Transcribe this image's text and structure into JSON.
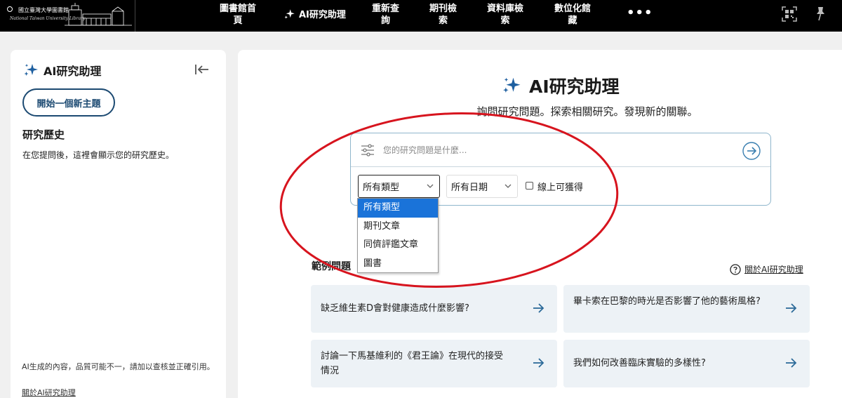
{
  "topbar": {
    "logo_line1": "國立臺灣大學圖書館",
    "logo_line2": "National Taiwan University Library",
    "nav": [
      {
        "label": "圖書館首\n頁"
      },
      {
        "label": "AI研究助理"
      },
      {
        "label": "重新查\n詢"
      },
      {
        "label": "期刊檢\n索"
      },
      {
        "label": "資料庫檢\n索"
      },
      {
        "label": "數位化館\n藏"
      }
    ],
    "more": "•••",
    "icons": [
      "qr-code-icon",
      "pin-icon",
      "sparkle-icon"
    ]
  },
  "sidebar": {
    "title": "AI研究助理",
    "new_topic_button": "開始一個新主題",
    "history_title": "研究歷史",
    "history_desc": "在您提問後，這裡會顯示您的研究歷史。",
    "disclaimer": "AI生成的內容，品質可能不一，請加以查核並正確引用。",
    "about_link": "關於AI研究助理",
    "icons": [
      "sparkle-icon",
      "collapse-sidebar-icon"
    ]
  },
  "main": {
    "title": "AI研究助理",
    "subtitle": "詢問研究問題。探索相關研究。發現新的關聯。",
    "search": {
      "placeholder": "您的研究問題是什麼...",
      "type_selected": "所有類型",
      "date_selected": "所有日期",
      "online_label": "線上可獲得",
      "online_checked": false
    },
    "type_options": [
      "所有類型",
      "期刊文章",
      "同儕評鑑文章",
      "圖書"
    ],
    "examples_label": "範例問題",
    "about_link": "關於AI研究助理",
    "examples": [
      {
        "text": "缺乏維生素D會對健康造成什麼影響?"
      },
      {
        "text": "畢卡索在巴黎的時光是否影響了他的藝術風格?"
      },
      {
        "text": "討論一下馬基維利的《君王論》在現代的接受情況"
      },
      {
        "text": "我們如何改善臨床實驗的多樣性?"
      }
    ]
  },
  "colors": {
    "topbar_bg": "#000000",
    "accent_navy": "#1c4a72",
    "sparkle_blue": "#1e5fa0",
    "selected_option": "#1a73d9",
    "card_bg": "#edf2f6",
    "annotation_red": "#d7141e"
  }
}
